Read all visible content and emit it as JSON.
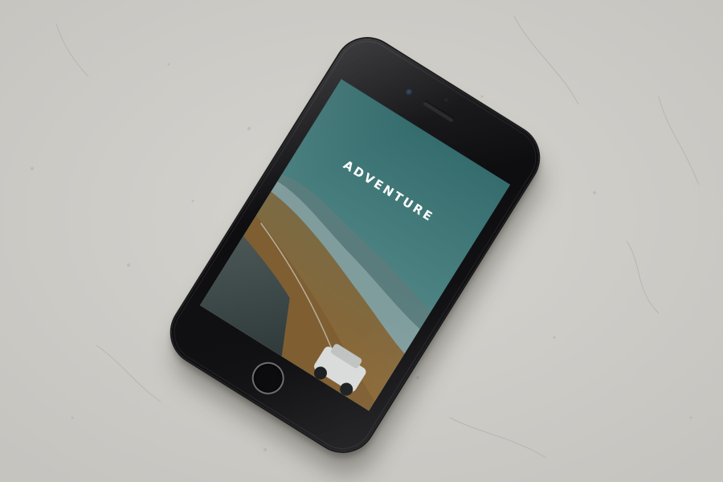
{
  "app": {
    "title": "ADVENTURE"
  },
  "colors": {
    "background": "#cfcdc8",
    "phone_body": "#111113",
    "screen_sky": "#3e7373",
    "screen_land": "#8a6a3a",
    "title_text": "#ffffff"
  },
  "icons": {
    "home_button": "home-button-icon",
    "camera": "front-camera-icon",
    "speaker": "earpiece-speaker-icon"
  }
}
